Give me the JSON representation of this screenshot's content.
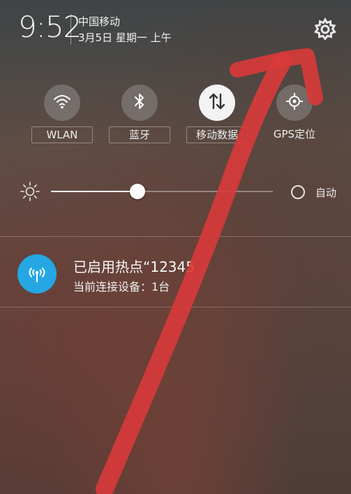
{
  "status": {
    "time": "9:52",
    "carrier": "中国移动",
    "date": "3月5日 星期一 上午"
  },
  "header": {
    "settings_icon": "gear-icon"
  },
  "quick_settings": [
    {
      "id": "wlan",
      "label": "WLAN",
      "icon": "wifi-icon",
      "active": false
    },
    {
      "id": "bluetooth",
      "label": "蓝牙",
      "icon": "bluetooth-icon",
      "active": false
    },
    {
      "id": "mobile-data",
      "label": "移动数据",
      "icon": "data-arrows-icon",
      "active": true
    },
    {
      "id": "gps",
      "label": "GPS定位",
      "icon": "location-icon",
      "active": false
    }
  ],
  "brightness": {
    "level": 0.39,
    "auto_label": "自动",
    "auto_enabled": false
  },
  "notification": {
    "title": "已启用热点“12345",
    "subtitle": "当前连接设备：1台",
    "icon": "hotspot-icon",
    "icon_color": "#24a7e3"
  },
  "annotation": {
    "color": "#d93a3a"
  }
}
